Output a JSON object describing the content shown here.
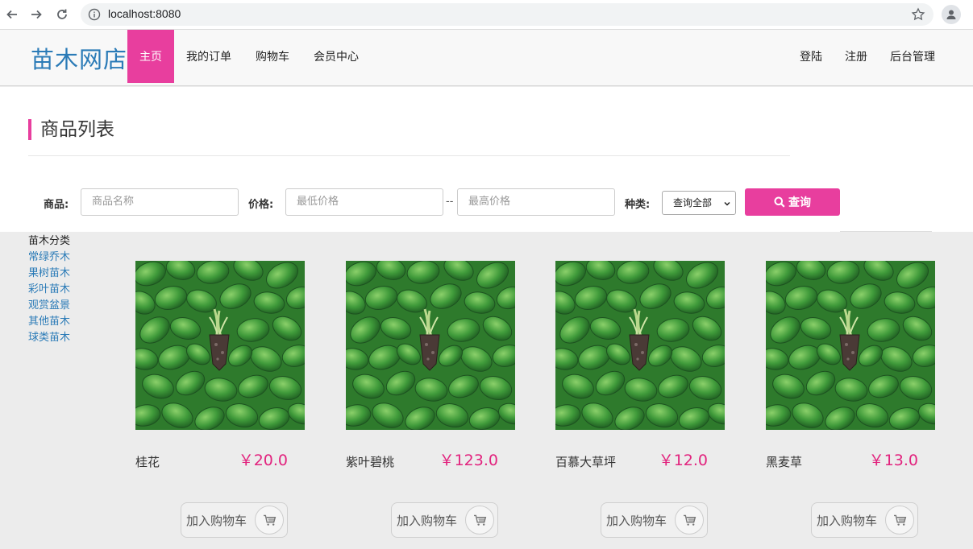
{
  "browser": {
    "url": "localhost:8080"
  },
  "header": {
    "logo": "苗木网店",
    "nav": [
      {
        "label": "主页",
        "active": true
      },
      {
        "label": "我的订单",
        "active": false
      },
      {
        "label": "购物车",
        "active": false
      },
      {
        "label": "会员中心",
        "active": false
      }
    ],
    "nav_right": [
      {
        "label": "登陆"
      },
      {
        "label": "注册"
      },
      {
        "label": "后台管理"
      }
    ]
  },
  "main": {
    "title": "商品列表",
    "search": {
      "product_label": "商品:",
      "product_placeholder": "商品名称",
      "price_label": "价格:",
      "min_placeholder": "最低价格",
      "separator": "--",
      "max_placeholder": "最高价格",
      "type_label": "种类:",
      "type_selected": "查询全部",
      "query_button": "查询"
    }
  },
  "sidebar": {
    "heading": "苗木分类",
    "categories": [
      "常绿乔木",
      "果树苗木",
      "彩叶苗木",
      "观赏盆景",
      "其他苗木",
      "球类苗木"
    ]
  },
  "products": [
    {
      "name": "桂花",
      "price": "￥20.0",
      "cart_label": "加入购物车"
    },
    {
      "name": "紫叶碧桃",
      "price": "￥123.0",
      "cart_label": "加入购物车"
    },
    {
      "name": "百慕大草坪",
      "price": "￥12.0",
      "cart_label": "加入购物车"
    },
    {
      "name": "黑麦草",
      "price": "￥13.0",
      "cart_label": "加入购物车"
    }
  ],
  "colors": {
    "accent": "#e83e9e",
    "price": "#e2237e",
    "link": "#2b7bb7"
  }
}
